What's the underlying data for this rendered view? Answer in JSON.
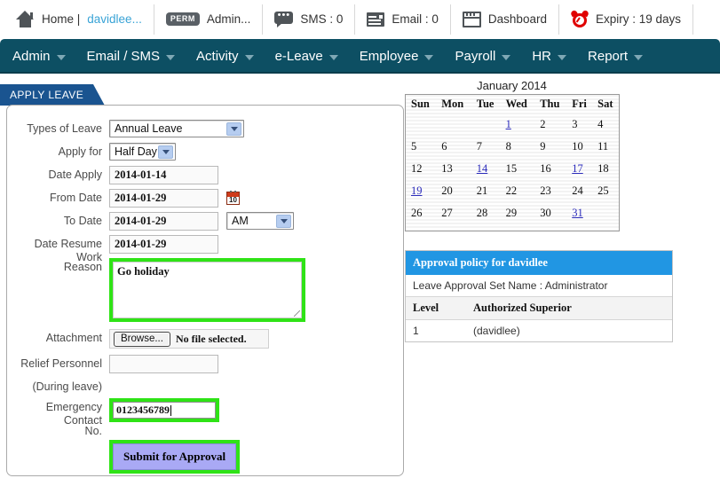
{
  "topbar": {
    "items": [
      {
        "icon": "home-icon",
        "label": "Home | ",
        "link": "davidlee...",
        "kind": "home"
      },
      {
        "icon": "perm-badge-icon",
        "label": "Admin...",
        "badge": "PERM",
        "kind": "perm"
      },
      {
        "icon": "sms-icon",
        "label": "SMS : 0",
        "kind": "sms"
      },
      {
        "icon": "email-icon",
        "label": "Email : 0",
        "kind": "mail"
      },
      {
        "icon": "dashboard-icon",
        "label": "Dashboard",
        "kind": "dash"
      },
      {
        "icon": "alarm-clock-icon",
        "label": "Expiry : 19 days",
        "kind": "clock"
      }
    ]
  },
  "nav": {
    "items": [
      {
        "label": "Admin"
      },
      {
        "label": "Email / SMS"
      },
      {
        "label": "Activity"
      },
      {
        "label": "e-Leave"
      },
      {
        "label": "Employee"
      },
      {
        "label": "Payroll"
      },
      {
        "label": "HR"
      },
      {
        "label": "Report"
      }
    ]
  },
  "panel": {
    "tab_label": "APPLY LEAVE",
    "fields": {
      "types_of_leave_label": "Types of Leave",
      "types_of_leave_value": "Annual Leave",
      "apply_for_label": "Apply for",
      "apply_for_value": "Half Day",
      "date_apply_label": "Date Apply",
      "date_apply_value": "2014-01-14",
      "from_date_label": "From Date",
      "from_date_value": "2014-01-29",
      "to_date_label": "To Date",
      "to_date_value": "2014-01-29",
      "am_pm_value": "AM",
      "date_resume_label": "Date Resume Work",
      "date_resume_value": "2014-01-29",
      "reason_label": "Reason",
      "reason_value": "Go holiday",
      "attachment_label": "Attachment",
      "browse_label": "Browse...",
      "no_file_text": "No file selected.",
      "relief_label": "Relief Personnel",
      "relief_value": "",
      "during_leave_label": "(During leave)",
      "emergency_label": "Emergency Contact",
      "emergency_value": "0123456789",
      "emergency_label2": "No.",
      "submit_label": "Submit for Approval",
      "calendar_icon_day": "10"
    }
  },
  "calendar": {
    "title": "January 2014",
    "weekdays": [
      "Sun",
      "Mon",
      "Tue",
      "Wed",
      "Thu",
      "Fri",
      "Sat"
    ],
    "weeks": [
      [
        "",
        "",
        "",
        "1",
        "2",
        "3",
        "4"
      ],
      [
        "5",
        "6",
        "7",
        "8",
        "9",
        "10",
        "11"
      ],
      [
        "12",
        "13",
        "14",
        "15",
        "16",
        "17",
        "18"
      ],
      [
        "19",
        "20",
        "21",
        "22",
        "23",
        "24",
        "25"
      ],
      [
        "26",
        "27",
        "28",
        "29",
        "30",
        "31",
        ""
      ]
    ],
    "linked_days": [
      "1",
      "14",
      "17",
      "19",
      "31"
    ]
  },
  "approval": {
    "header": "Approval policy for davidlee",
    "set_name_line": "Leave Approval Set Name : Administrator",
    "columns": [
      "Level",
      "Authorized Superior"
    ],
    "rows": [
      {
        "level": "1",
        "superior": "(davidlee)"
      }
    ]
  },
  "colors": {
    "navbar": "#0d4f63",
    "tab": "#1a5490",
    "highlight_green": "#2fe316",
    "submit_bg": "#a9a9f5",
    "approval_header": "#2196e3",
    "link_blue": "#2b2bbb"
  }
}
